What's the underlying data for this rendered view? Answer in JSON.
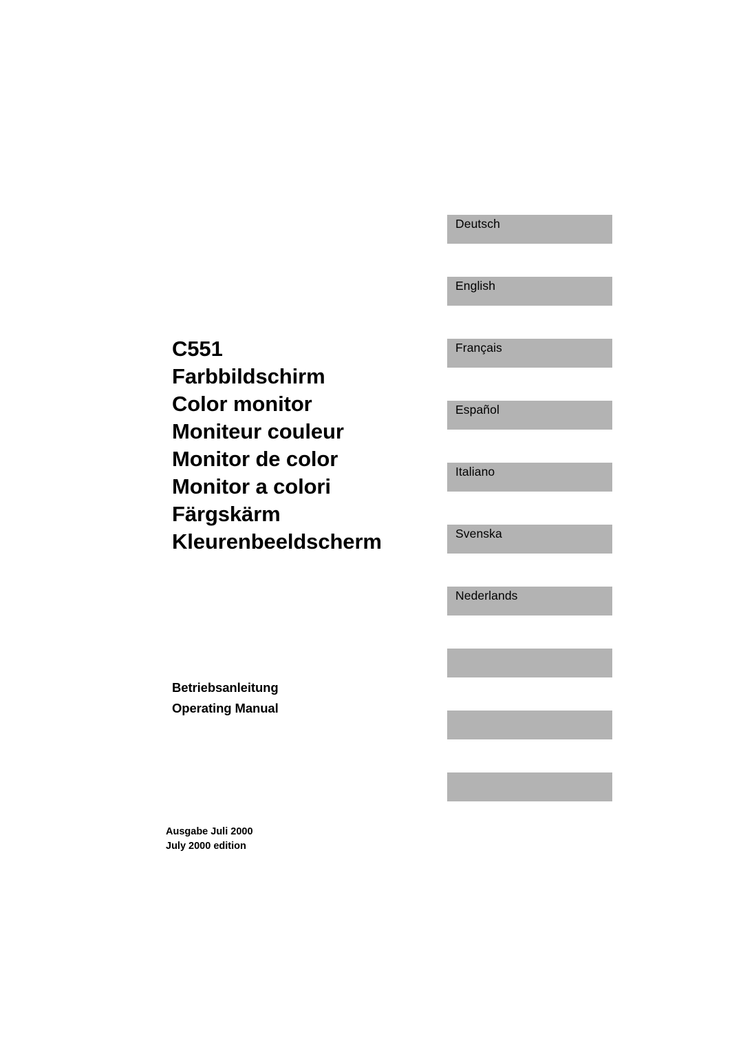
{
  "page": {
    "background_color": "#ffffff",
    "text_color": "#000000"
  },
  "title": {
    "model": "C551",
    "lines": [
      "C551",
      "Farbbildschirm",
      "Color monitor",
      "Moniteur couleur",
      "Monitor de color",
      "Monitor a colori",
      "Färgskärm",
      "Kleurenbeeldscherm"
    ]
  },
  "language_tabs": {
    "block_color": "#b3b3b3",
    "items": [
      {
        "label": "Deutsch",
        "blank": false
      },
      {
        "label": "English",
        "blank": false
      },
      {
        "label": "Français",
        "blank": false
      },
      {
        "label": "Español",
        "blank": false
      },
      {
        "label": "Italiano",
        "blank": false
      },
      {
        "label": "Svenska",
        "blank": false
      },
      {
        "label": "Nederlands",
        "blank": false
      },
      {
        "label": "",
        "blank": true
      },
      {
        "label": "",
        "blank": true
      },
      {
        "label": "",
        "blank": true
      }
    ]
  },
  "manual_type": {
    "lines": [
      "Betriebsanleitung",
      "Operating Manual"
    ]
  },
  "edition": {
    "lines": [
      "Ausgabe Juli 2000",
      "July 2000 edition"
    ]
  }
}
